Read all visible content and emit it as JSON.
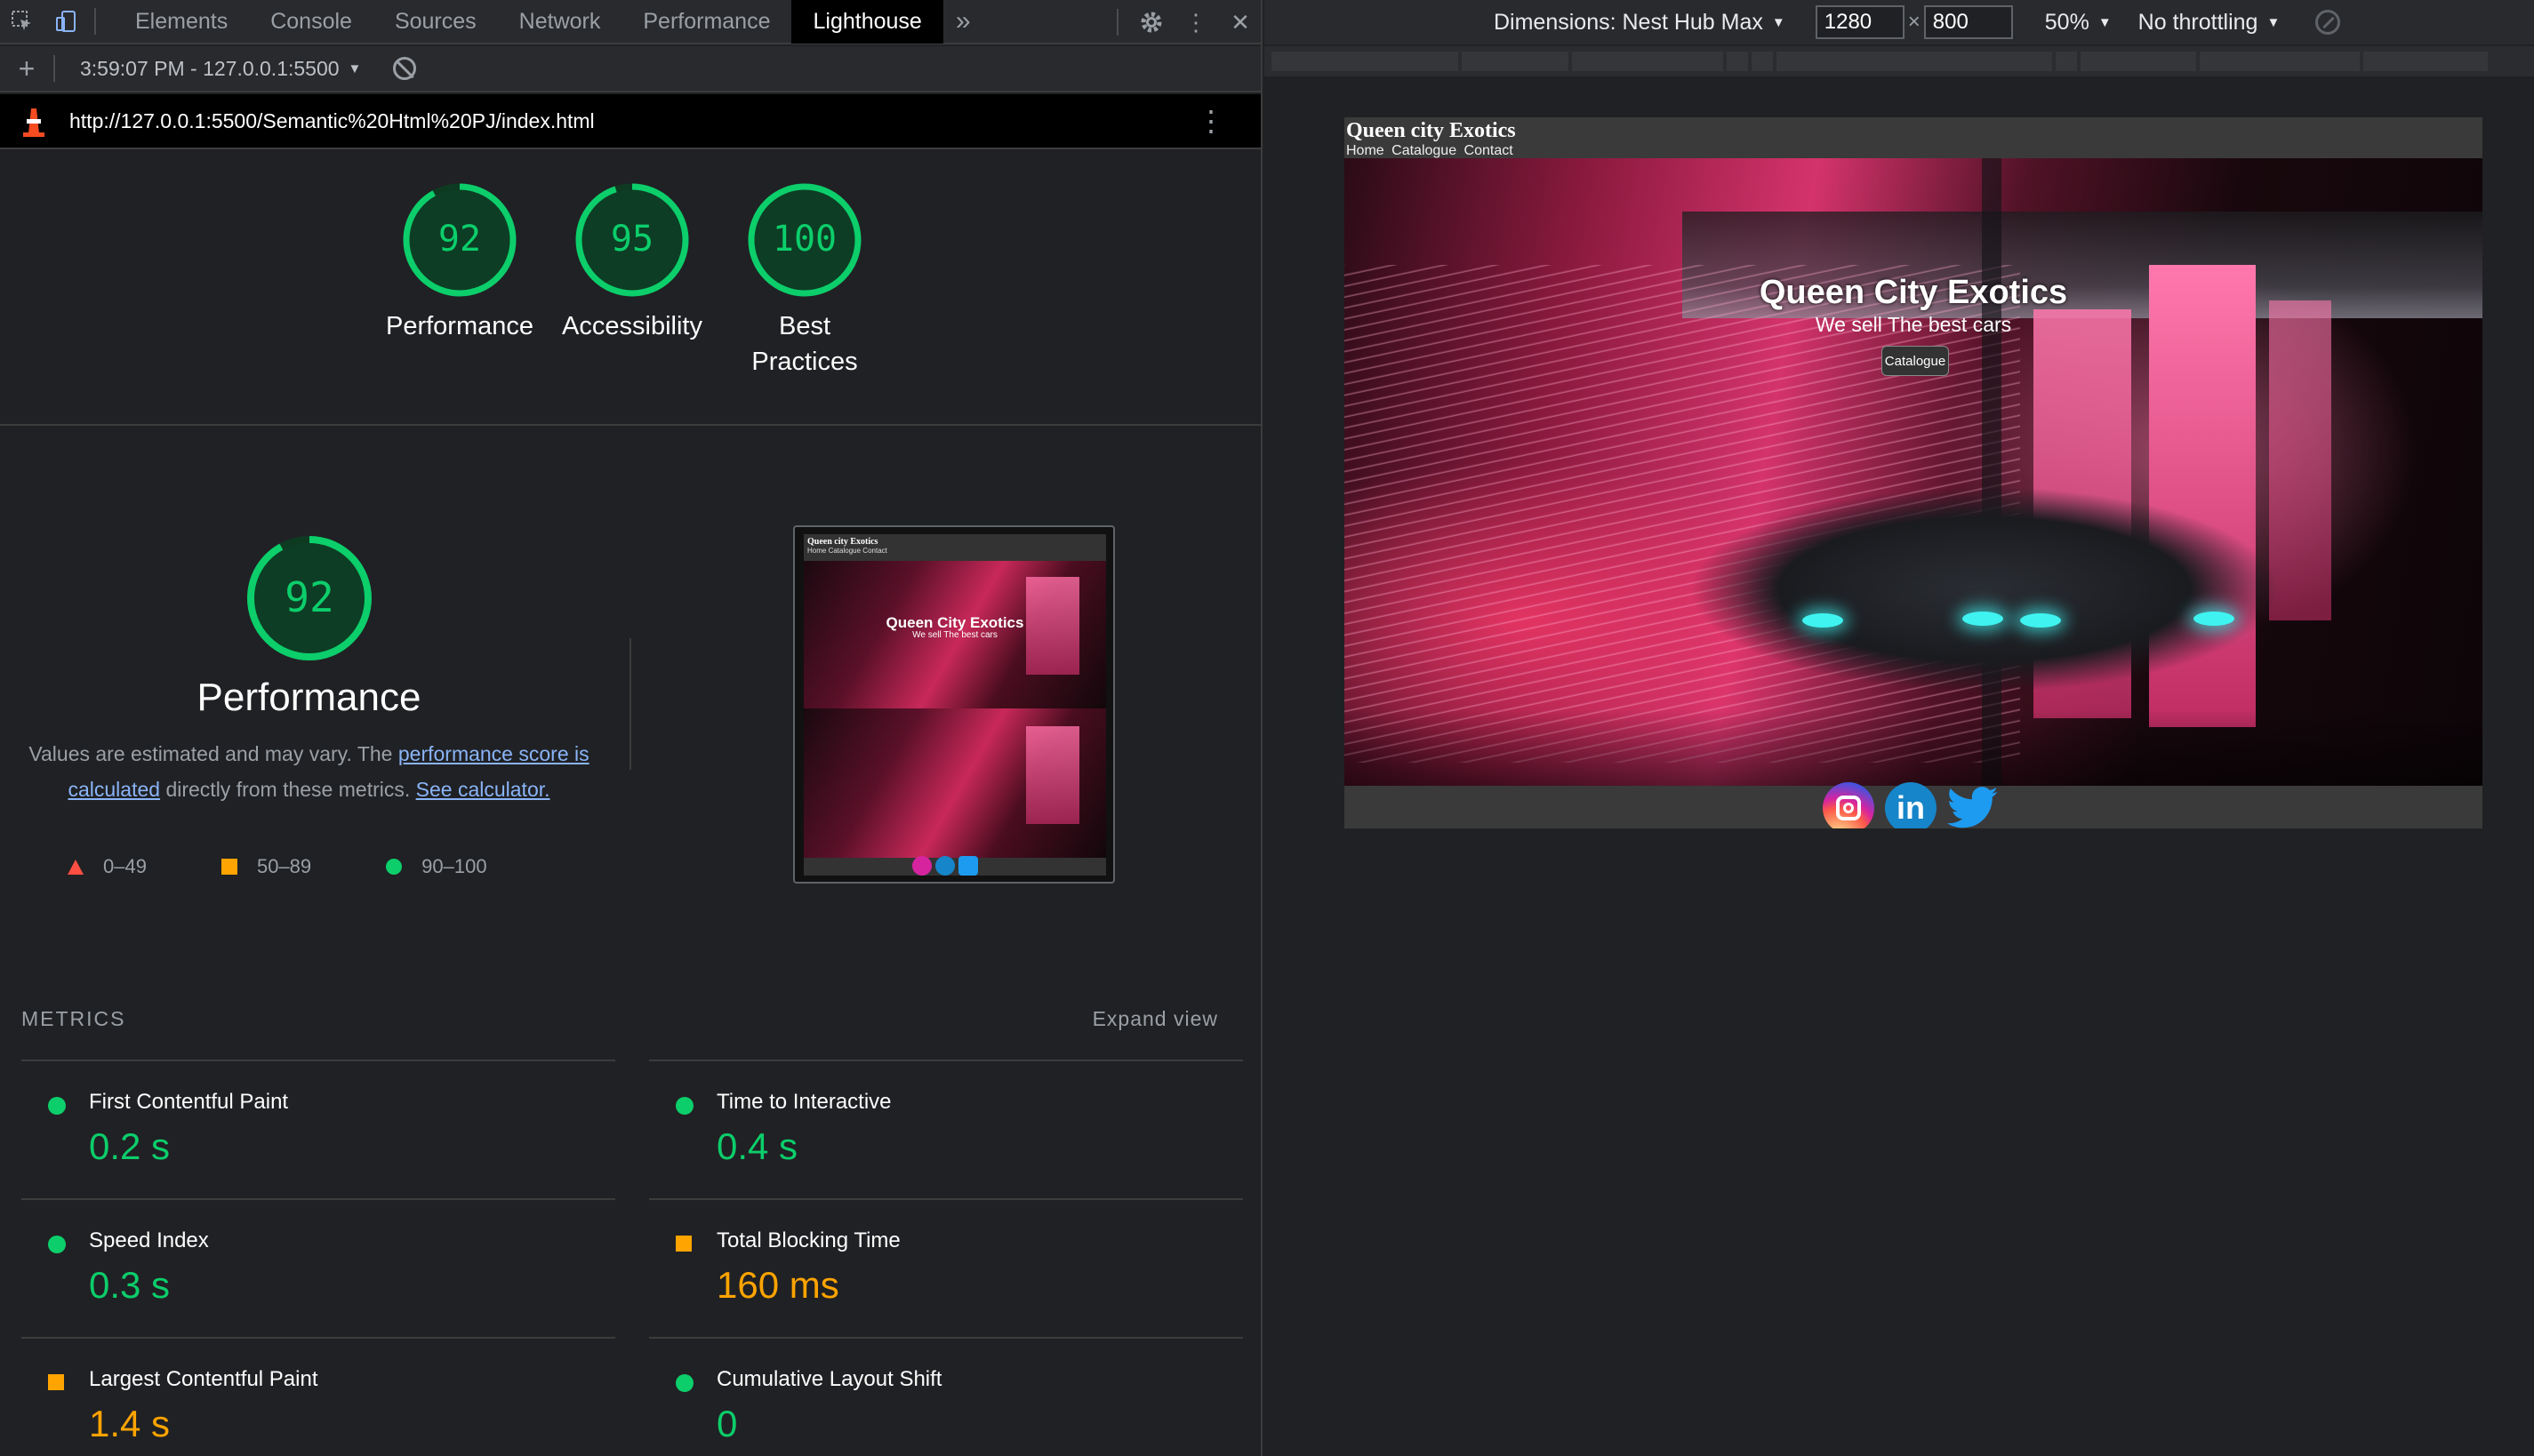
{
  "devtools": {
    "tabs": [
      "Elements",
      "Console",
      "Sources",
      "Network",
      "Performance",
      "Lighthouse"
    ],
    "active_tab": "Lighthouse",
    "more_tabs_label": "»",
    "report_time": "3:59:07 PM - 127.0.0.1:5500",
    "url": "http://127.0.0.1:5500/Semantic%20Html%20PJ/index.html"
  },
  "scores": [
    {
      "label": "Performance",
      "value": "92",
      "fraction": 0.92
    },
    {
      "label": "Accessibility",
      "value": "95",
      "fraction": 0.95
    },
    {
      "label": "Best Practices",
      "value": "100",
      "fraction": 1.0
    }
  ],
  "performance": {
    "score": "92",
    "score_fraction": 0.92,
    "title": "Performance",
    "desc_prefix": "Values are estimated and may vary. The ",
    "link1": "performance score is calculated",
    "desc_middle": " directly from these metrics. ",
    "link2": "See calculator.",
    "legend": [
      "0–49",
      "50–89",
      "90–100"
    ]
  },
  "metrics": {
    "heading": "METRICS",
    "expand_label": "Expand view",
    "items": [
      {
        "name": "First Contentful Paint",
        "value": "0.2 s",
        "rating": "good"
      },
      {
        "name": "Time to Interactive",
        "value": "0.4 s",
        "rating": "good"
      },
      {
        "name": "Speed Index",
        "value": "0.3 s",
        "rating": "good"
      },
      {
        "name": "Total Blocking Time",
        "value": "160 ms",
        "rating": "average"
      },
      {
        "name": "Largest Contentful Paint",
        "value": "1.4 s",
        "rating": "average"
      },
      {
        "name": "Cumulative Layout Shift",
        "value": "0",
        "rating": "good"
      }
    ]
  },
  "device_toolbar": {
    "dimensions_label": "Dimensions: Nest Hub Max",
    "width": "1280",
    "height": "800",
    "times": "×",
    "zoom": "50%",
    "throttling": "No throttling"
  },
  "site": {
    "title": "Queen city Exotics",
    "nav": [
      "Home",
      "Catalogue",
      "Contact"
    ],
    "hero_title": "Queen City Exotics",
    "hero_subtitle": "We sell The best cars",
    "cta_label": "Catalogue",
    "social": [
      "instagram",
      "linkedin",
      "twitter"
    ],
    "linkedin_text": "in"
  },
  "colors": {
    "good": "#0cce6b",
    "average": "#ffa400",
    "fail": "#ff4e42",
    "link": "#8ab4f8",
    "active_tab_bg": "#000000"
  }
}
